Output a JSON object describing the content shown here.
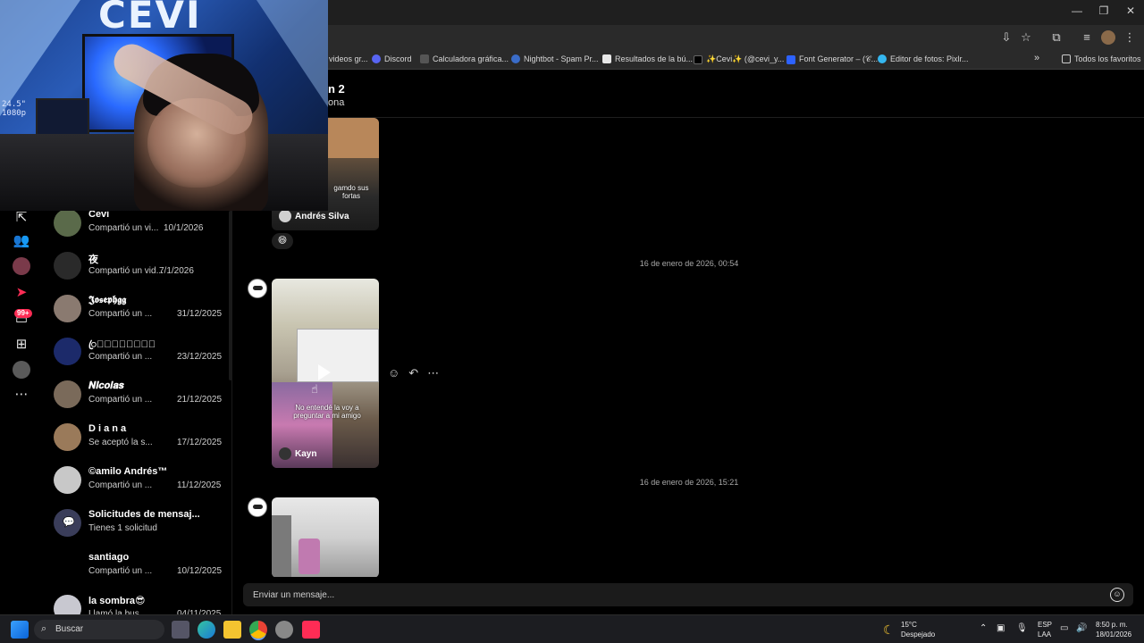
{
  "window": {
    "minimize": "—",
    "restore": "❐",
    "close": "✕"
  },
  "bookmarks": [
    {
      "label": "videos gr...",
      "color": "#3a3a3a"
    },
    {
      "label": "Discord",
      "color": "#5865f2"
    },
    {
      "label": "Calculadora gráfica...",
      "color": "#3a3a3a"
    },
    {
      "label": "Nightbot - Spam Pr...",
      "color": "#3a6cc8"
    },
    {
      "label": "Resultados de la bú...",
      "color": "#e8e8e8"
    },
    {
      "label": "✨Cevi✨ (@cevi_y...",
      "color": "#000000"
    },
    {
      "label": "Font Generator – (𝒞...",
      "color": "#2d62ff"
    },
    {
      "label": "Editor de fotos: Pixlr...",
      "color": "#35b7f0"
    }
  ],
  "bookmarks_more": "»",
  "all_favorites": "Todos los favoritos",
  "webcam": {
    "logo": "CEVI",
    "refresh": "24.5\"\n1080p"
  },
  "conversations": [
    {
      "name": "Cevi",
      "subtitle": "Compartió un vi...",
      "date": "10/1/2026",
      "avatar_color": "#5a6a4a"
    },
    {
      "name": "夜",
      "subtitle": "Compartió un vid...",
      "date": "7/1/2026",
      "avatar_color": "#2a2a2a"
    },
    {
      "name": "𝕵𝖔𝖘𝖊𝖕𝖍𝖌𝖌",
      "subtitle": "Compartió un ...",
      "date": "31/12/2025",
      "avatar_color": "#8a7a70"
    },
    {
      "name": "ꦿ𝐑𝐀𝐍𝐃𝐀𝐋𝐋ꦿ",
      "subtitle": "Compartió un ...",
      "date": "23/12/2025",
      "avatar_color": "#1c2a6a"
    },
    {
      "name": "𝑵𝒊𝒄𝒐𝒍𝒂𝒔",
      "subtitle": "Compartió un ...",
      "date": "21/12/2025",
      "avatar_color": "#7a6a5a"
    },
    {
      "name": "D i a n a",
      "subtitle": "Se aceptó la s...",
      "date": "17/12/2025",
      "avatar_color": "#9a7a5a"
    },
    {
      "name": "©amilo Andrés™",
      "subtitle": "Compartió un ...",
      "date": "11/12/2025",
      "avatar_color": "#c8c8c8"
    },
    {
      "name": "Solicitudes de mensaj...",
      "subtitle": "Tienes 1 solicitud",
      "date": "",
      "avatar_color": "#3a3d5a"
    },
    {
      "name": "santiago",
      "subtitle": "Compartió un ...",
      "date": "10/12/2025",
      "avatar_color": "#000000"
    },
    {
      "name": "la sombra😎",
      "subtitle": "Llamó la bus...",
      "date": "04/11/2025",
      "avatar_color": "#c8c8d0"
    }
  ],
  "chat": {
    "title": "n 2",
    "subtitle": "ona",
    "first_card": {
      "caption": "gamdo sus fortas",
      "author": "Andrés Silva",
      "reaction": "😄"
    },
    "date1": "16 de enero de 2026, 00:54",
    "second_card": {
      "caption": "No entendé la voy a preguntar a mi amigo",
      "author": "Kayn"
    },
    "actions": [
      "☺",
      "↶",
      "⋯"
    ],
    "date2": "16 de enero de 2026, 15:21"
  },
  "composer": {
    "placeholder": "Enviar un mensaje...",
    "emoji": "☺"
  },
  "taskbar": {
    "search_label": "Buscar",
    "weather_temp": "15°C",
    "weather_desc": "Despejado",
    "lang1": "ESP",
    "lang2": "LAA",
    "time": "8:50 p. m.",
    "date": "18/01/2026"
  }
}
